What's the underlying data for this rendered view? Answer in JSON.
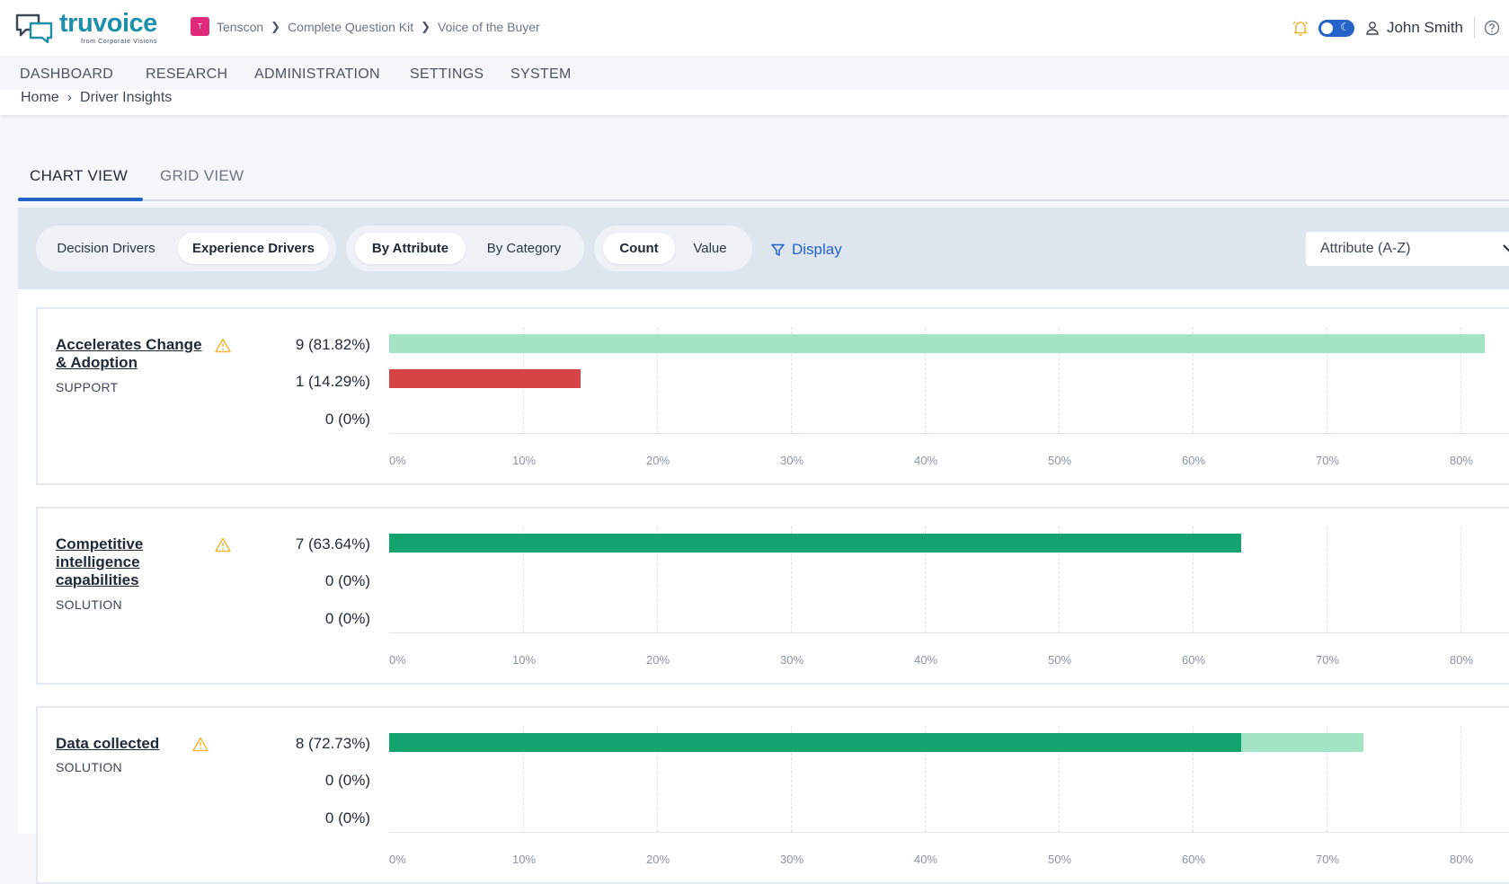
{
  "brand": {
    "name": "truvoice",
    "tagline": "from Corporate Visions"
  },
  "top_breadcrumb": {
    "badge": "T",
    "items": [
      "Tenscon",
      "Complete Question Kit",
      "Voice of the Buyer"
    ]
  },
  "user": {
    "name": "John Smith"
  },
  "nav": [
    "DASHBOARD",
    "RESEARCH",
    "ADMINISTRATION",
    "SETTINGS",
    "SYSTEM"
  ],
  "breadcrumb": [
    "Home",
    "Driver Insights"
  ],
  "view_tabs": {
    "chart": "CHART VIEW",
    "grid": "GRID VIEW",
    "active": "chart"
  },
  "filters": {
    "driver_type": {
      "options": [
        "Decision Drivers",
        "Experience Drivers"
      ],
      "selected": "Experience Drivers"
    },
    "grouping": {
      "options": [
        "By Attribute",
        "By Category"
      ],
      "selected": "By Attribute"
    },
    "measure": {
      "options": [
        "Count",
        "Value"
      ],
      "selected": "Count"
    },
    "display_label": "Display",
    "sort": "Attribute (A-Z)"
  },
  "colors": {
    "green_light": "#a3e4c6",
    "green_dark": "#13a36f",
    "red": "#d64545",
    "accent": "#2563c9",
    "warning": "#f3b63b"
  },
  "chart_data": [
    {
      "type": "bar",
      "orientation": "horizontal",
      "title": "Accelerates Change & Adoption",
      "category": "SUPPORT",
      "xlim": [
        0,
        82
      ],
      "x_ticks": [
        "0%",
        "10%",
        "20%",
        "30%",
        "40%",
        "50%",
        "60%",
        "70%",
        "80%"
      ],
      "rows": [
        {
          "label": "9 (81.82%)",
          "segments": [
            {
              "value": 81.82,
              "color": "green_light"
            }
          ]
        },
        {
          "label": "1 (14.29%)",
          "segments": [
            {
              "value": 14.29,
              "color": "red"
            }
          ]
        },
        {
          "label": "0 (0%)",
          "segments": []
        }
      ]
    },
    {
      "type": "bar",
      "orientation": "horizontal",
      "title": "Competitive intelligence capabilities",
      "category": "SOLUTION",
      "xlim": [
        0,
        82
      ],
      "x_ticks": [
        "0%",
        "10%",
        "20%",
        "30%",
        "40%",
        "50%",
        "60%",
        "70%",
        "80%"
      ],
      "rows": [
        {
          "label": "7 (63.64%)",
          "segments": [
            {
              "value": 63.64,
              "color": "green_dark"
            }
          ]
        },
        {
          "label": "0 (0%)",
          "segments": []
        },
        {
          "label": "0 (0%)",
          "segments": []
        }
      ]
    },
    {
      "type": "bar",
      "orientation": "horizontal",
      "title": "Data collected",
      "category": "SOLUTION",
      "xlim": [
        0,
        82
      ],
      "x_ticks": [
        "0%",
        "10%",
        "20%",
        "30%",
        "40%",
        "50%",
        "60%",
        "70%",
        "80%"
      ],
      "rows": [
        {
          "label": "8 (72.73%)",
          "segments": [
            {
              "value": 63.64,
              "color": "green_dark"
            },
            {
              "value": 9.09,
              "color": "green_light"
            }
          ]
        },
        {
          "label": "0 (0%)",
          "segments": []
        },
        {
          "label": "0 (0%)",
          "segments": []
        }
      ]
    }
  ]
}
